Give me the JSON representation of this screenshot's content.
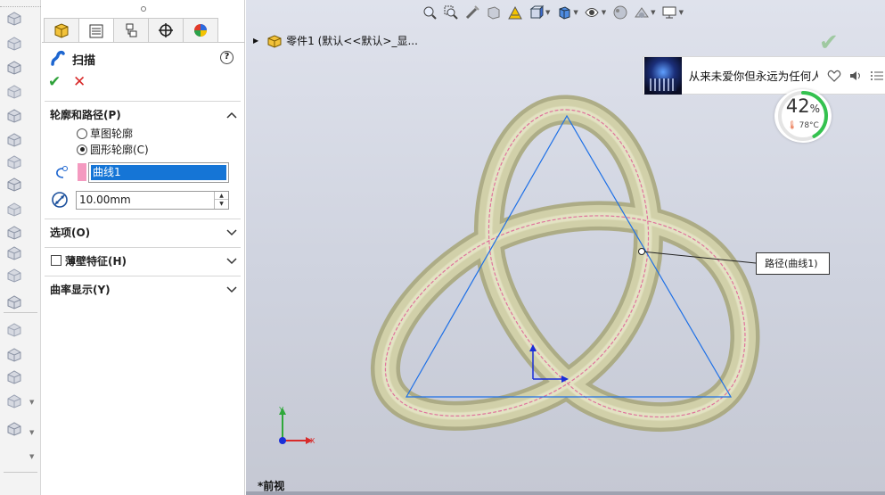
{
  "feature_bar": {
    "icons": [
      "extruded-boss-icon",
      "revolved-boss-icon",
      "swept-boss-icon",
      "extruded-cut-icon",
      "fillet-icon",
      "chamfer-icon",
      "plane-icon",
      "rib-icon",
      "shell-icon",
      "draft-icon",
      "wrap-icon",
      "dome-icon",
      "mirror-icon",
      "linear-pattern-icon",
      "circular-pattern-icon",
      "reference-geometry-icon",
      "curves-icon",
      "instant3d-icon"
    ]
  },
  "property_manager": {
    "tabs": [
      "feature-manager-tab",
      "property-manager-tab",
      "configuration-manager-tab",
      "dimxpert-tab",
      "display-manager-tab"
    ],
    "title": "扫描",
    "help_label": "?",
    "ok_label": "✔",
    "cancel_label": "✕",
    "groups": {
      "profile_path": {
        "header": "轮廓和路径(P)",
        "options": [
          {
            "label": "草图轮廓",
            "selected": false
          },
          {
            "label": "圆形轮廓(C)",
            "selected": true
          }
        ],
        "path_value": "曲线1",
        "diameter_value": "10.00mm"
      },
      "options": {
        "header": "选项(O)"
      },
      "thin": {
        "header": "薄壁特征(H)",
        "checked": false
      },
      "curvature": {
        "header": "曲率显示(Y)"
      }
    }
  },
  "viewport": {
    "tree_item": "零件1  (默认<<默认>_显...",
    "view_label": "*前视",
    "callout": "路径(曲线1)",
    "axes": {
      "x": "X",
      "y": "Y"
    },
    "colors": {
      "path_line": "#1e70e6",
      "sweep_body": "#c7c69c",
      "profile_dash": "#e0739c",
      "background_top": "#dfe2ec",
      "background_bottom": "#c5c8d3"
    }
  },
  "music_widget": {
    "song_title": "从来未爱你但永远为任何人"
  },
  "system_gauge": {
    "cpu_percent": "42",
    "percent_sign": "%",
    "temperature": "78°C",
    "fill_fraction": 0.42
  }
}
